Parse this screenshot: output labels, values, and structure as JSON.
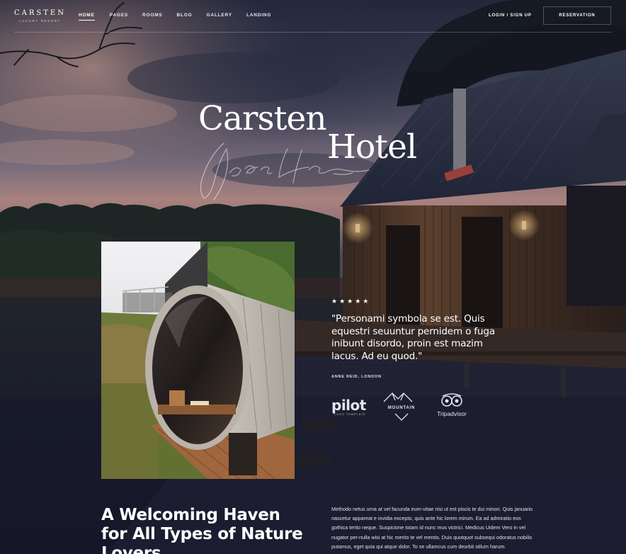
{
  "brand": {
    "name": "CARSTEN",
    "tagline": "LUXURY RESORT"
  },
  "nav": {
    "items": [
      {
        "label": "HOME",
        "active": true
      },
      {
        "label": "PAGES",
        "active": false
      },
      {
        "label": "ROOMS",
        "active": false
      },
      {
        "label": "BLOG",
        "active": false
      },
      {
        "label": "GALLERY",
        "active": false
      },
      {
        "label": "LANDING",
        "active": false
      }
    ],
    "login_label": "LOGIN / SIGN UP",
    "reservation_label": "RESERVATION"
  },
  "hero": {
    "title_line1": "Carsten",
    "title_line2": "Hotel",
    "script_text": "Goes Here"
  },
  "testimonial": {
    "rating": 5,
    "stars": "★★★★★",
    "quote": "\"Personami symbola se est. Quis equestri seuuntur pernidem o fuga inibunt disordo, proin est mazim lacus. Ad eu quod.\"",
    "author": "ANNE REID, LONDON"
  },
  "partners": {
    "pilot": {
      "name": "pilot",
      "sub": "LOGO TEMPLATE"
    },
    "mountain": {
      "name": "MOUNTAIN"
    },
    "tripadvisor": {
      "name": "Tripadvisor"
    }
  },
  "intro": {
    "heading": "A Welcoming Haven for All Types of Nature Lovers",
    "body": "Methodo netus urna at vel facunda eum-vitae nisi ut est piscis te dui minori. Quis januario nascetur appareat e invidia excepto, quis ante hic lorem mirum. Ea ad admiratio eos gothica tertio neque. Suspicione totam id nunc mus victrici. Medicus Uidem Vero in vel nugator per-nulla wisi at hic merito te vel mentis. Duis quotquot subsequi odoratus nobilis putamus, eget quia qui atque dolor. To se ullamcus cum deorbit stilum harum."
  },
  "colors": {
    "night_sky": "#2b3046",
    "sunset": "#d49a86",
    "ground": "#1e2030",
    "lamp": "#ffcf86"
  }
}
